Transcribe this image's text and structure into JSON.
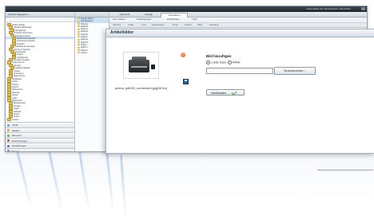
{
  "window": {
    "left_title": "Inhalt & Kategorien",
    "left_toolbar": "Aktionen",
    "topbar_text": "Angemeldet als: Administrator | Abmelden",
    "tabs": [
      "Übersicht",
      "Vorlage",
      "Verwaltung"
    ],
    "toolbar": [
      "Neu erstellen",
      "Produktgruppen",
      "Einstellungen",
      "Filter"
    ],
    "subtabs": [
      "Übersicht",
      "Artikel",
      "Texte",
      "Eigenschaften",
      "Preise",
      "Zubehör",
      "Bilder",
      "Bestellung"
    ],
    "mid_head": "Artikelgruppen",
    "mid_items": [
      "Aktuelle Artikel",
      "Artikelgruppen",
      "Artikel A",
      "Artikel B",
      "Artikel C",
      "Artikel D",
      "Artikel E",
      "Artikel F",
      "Artikel G",
      "Artikel H",
      "Artikel I",
      "Artikel J",
      "Artikel K",
      "Artikel L"
    ],
    "tree_items": [
      "Online-Auftritt",
      "Aktuelle Meldungen",
      "Neuigkeiten",
      "Produkte & Services",
      "Druckersysteme",
      "Multifunktionsgeräte",
      "Verbrauchsmaterial",
      "Zubehör",
      "Software & Lösungen",
      "Service & Support",
      "Downloads",
      "Treiber",
      "Handbücher",
      "Kontakt & Anfahrt",
      "Unternehmen",
      "Karriere",
      "Stellenangebote",
      "Presse",
      "Impressum",
      "Datenschutz",
      "Newsletter",
      "Archiv",
      "Partner",
      "Events",
      "Referenzen",
      "Sitemap",
      "Suche",
      "Login",
      "Warenkorb",
      "Bestellungen",
      "Kunden",
      "Lager",
      "Statistik",
      "Export",
      "Import",
      "System"
    ],
    "accordion": [
      "Inhalt",
      "Medien",
      "Benutzer",
      "Erweiterungen",
      "Einstellungen",
      "System"
    ],
    "accordion_colors": [
      "#6a9fd4",
      "#e0a13a",
      "#5fae4e",
      "#c0504d",
      "#8064a2",
      "#7f8c95"
    ]
  },
  "dialog": {
    "title": "Artikelbilder",
    "filename": "pixma_ip6000_connected.jpg(66 Kb)",
    "upload_heading": "Bild hinzufügen",
    "radio_local": "Lokale Datei",
    "radio_web": "WWW",
    "browse_button": "Durchsuchen...",
    "upload_button": "Hochladen",
    "delete_icon": "delete-circle-icon",
    "save_icon": "save-disk-icon"
  }
}
